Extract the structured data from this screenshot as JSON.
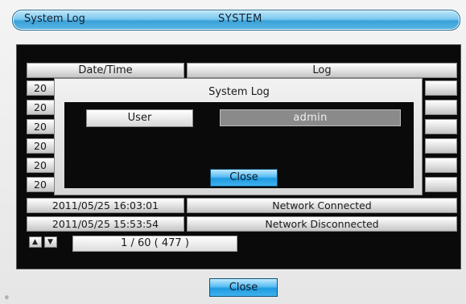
{
  "window": {
    "title_left": "System Log",
    "title_center": "SYSTEM"
  },
  "table": {
    "headers": [
      "Date/Time",
      "Log"
    ],
    "hidden_row_prefixes": [
      "20",
      "20",
      "20",
      "20",
      "20",
      "20"
    ],
    "visible_rows": [
      {
        "datetime": "2011/05/25 16:03:01",
        "log": "Network Connected"
      },
      {
        "datetime": "2011/05/25 15:53:54",
        "log": "Network Disconnected"
      }
    ]
  },
  "pager": {
    "label": "1 / 60 ( 477 )",
    "up_icon": "triangle-up-icon",
    "down_icon": "triangle-down-icon"
  },
  "dialog": {
    "title": "System Log",
    "field_label": "User",
    "field_value": "admin",
    "close_label": "Close"
  },
  "footer": {
    "close_label": "Close",
    "corner_mark": "e"
  }
}
